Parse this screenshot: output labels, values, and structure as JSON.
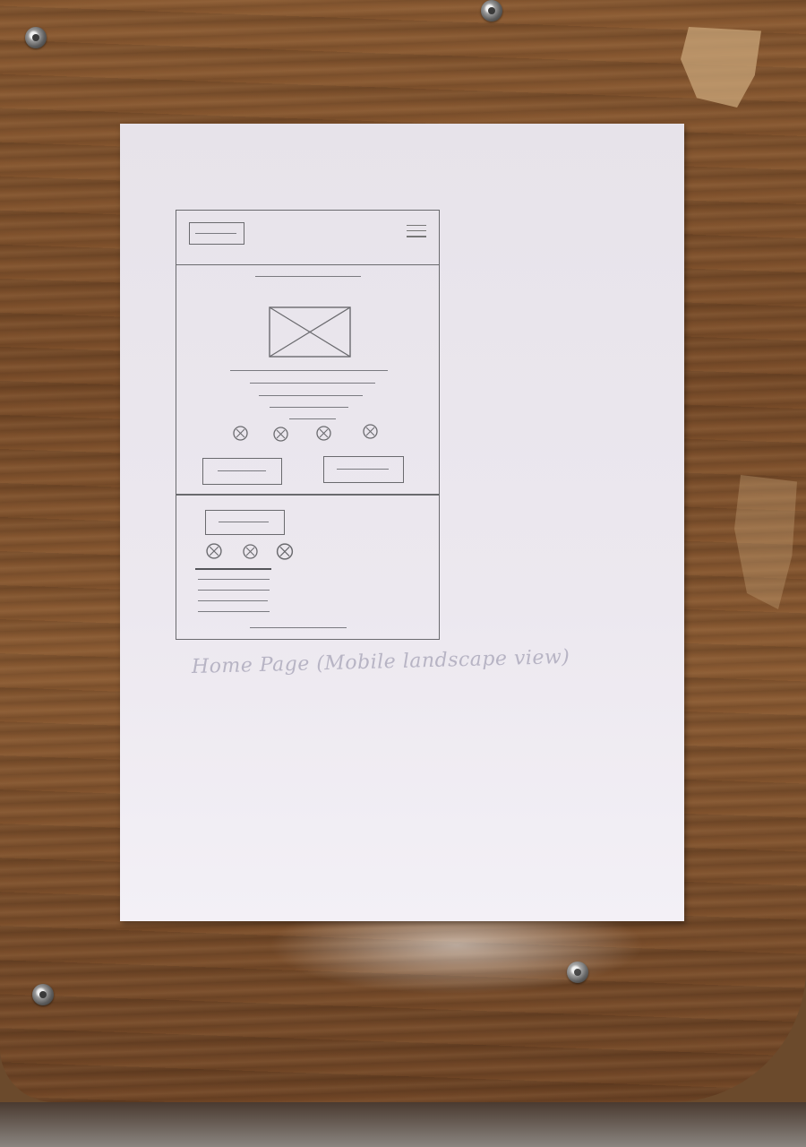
{
  "caption": "Home Page (Mobile landscape view)",
  "wireframe": {
    "header": {
      "logo": "logo-box",
      "menu_icon": "hamburger-menu-icon"
    },
    "hero": {
      "image": "image-placeholder",
      "text_lines": 5,
      "icons": 4,
      "buttons": 2
    },
    "section": {
      "button": 1,
      "icons": 3,
      "text_lines": 4
    }
  },
  "colors": {
    "paper": "#ece8ef",
    "pencil": "#6a6a6e",
    "wood": "#7a4d2a"
  }
}
